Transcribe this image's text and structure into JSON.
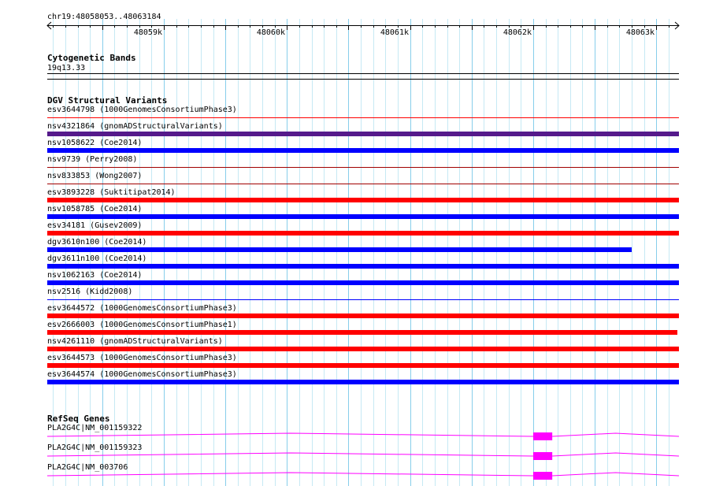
{
  "ruler": {
    "location": "chr19:48058053..48063184",
    "start": 48058053,
    "end": 48063184,
    "major_ticks": [
      {
        "pos": 48059000,
        "label": "48059k"
      },
      {
        "pos": 48060000,
        "label": "48060k"
      },
      {
        "pos": 48061000,
        "label": "48061k"
      },
      {
        "pos": 48062000,
        "label": "48062k"
      },
      {
        "pos": 48063000,
        "label": "48063k"
      }
    ]
  },
  "tracks": {
    "cytoband": {
      "title": "Cytogenetic Bands",
      "band_label": "19q13.33",
      "color": "#000000"
    },
    "dgv": {
      "title": "DGV Structural Variants",
      "features": [
        {
          "label": "esv3644798 (1000GenomesConsortiumPhase3)",
          "color": "#ff0000",
          "style": "line",
          "start": 48058053,
          "end": 48063184
        },
        {
          "label": "nsv4321864 (gnomADStructuralVariants)",
          "color": "#551a8b",
          "style": "bar",
          "start": 48058053,
          "end": 48063184
        },
        {
          "label": "nsv1058622 (Coe2014)",
          "color": "#0000ff",
          "style": "bar",
          "start": 48058053,
          "end": 48063184
        },
        {
          "label": "nsv9739 (Perry2008)",
          "color": "#a00000",
          "style": "line",
          "start": 48058053,
          "end": 48063184
        },
        {
          "label": "nsv833853 (Wong2007)",
          "color": "#a00000",
          "style": "line",
          "start": 48058053,
          "end": 48063184
        },
        {
          "label": "esv3893228 (Suktitipat2014)",
          "color": "#ff0000",
          "style": "bar",
          "start": 48058053,
          "end": 48063184
        },
        {
          "label": "nsv1058785 (Coe2014)",
          "color": "#0000ff",
          "style": "bar",
          "start": 48058053,
          "end": 48063184
        },
        {
          "label": "esv34181 (Gusev2009)",
          "color": "#ff0000",
          "style": "bar",
          "start": 48058053,
          "end": 48063184
        },
        {
          "label": "dgv3610n100 (Coe2014)",
          "color": "#0000ff",
          "style": "bar",
          "start": 48058053,
          "end": 48062800
        },
        {
          "label": "dgv3611n100 (Coe2014)",
          "color": "#0000ff",
          "style": "bar",
          "start": 48058053,
          "end": 48063184
        },
        {
          "label": "nsv1062163 (Coe2014)",
          "color": "#0000ff",
          "style": "bar",
          "start": 48058053,
          "end": 48063184
        },
        {
          "label": "nsv2516 (Kidd2008)",
          "color": "#0000ff",
          "style": "line",
          "start": 48058053,
          "end": 48063184
        },
        {
          "label": "esv3644572 (1000GenomesConsortiumPhase3)",
          "color": "#ff0000",
          "style": "bar",
          "start": 48058053,
          "end": 48063184
        },
        {
          "label": "esv2666003 (1000GenomesConsortiumPhase1)",
          "color": "#ff0000",
          "style": "bar",
          "start": 48058053,
          "end": 48063170
        },
        {
          "label": "nsv4261110 (gnomADStructuralVariants)",
          "color": "#ff0000",
          "style": "bar",
          "start": 48058053,
          "end": 48063184
        },
        {
          "label": "esv3644573 (1000GenomesConsortiumPhase3)",
          "color": "#ff0000",
          "style": "bar",
          "start": 48058053,
          "end": 48063184
        },
        {
          "label": "esv3644574 (1000GenomesConsortiumPhase3)",
          "color": "#0000ff",
          "style": "bar",
          "start": 48058053,
          "end": 48063184
        }
      ]
    },
    "refseq": {
      "title": "RefSeq Genes",
      "color": "#ff00ff",
      "genes": [
        {
          "label": "PLA2G4C|NM_001159322",
          "start": 48058053,
          "end": 48063184,
          "exons": [
            {
              "start": 48062000,
              "end": 48062155
            }
          ]
        },
        {
          "label": "PLA2G4C|NM_001159323",
          "start": 48058053,
          "end": 48063184,
          "exons": [
            {
              "start": 48062000,
              "end": 48062155
            }
          ]
        },
        {
          "label": "PLA2G4C|NM_003706",
          "start": 48058053,
          "end": 48063184,
          "exons": [
            {
              "start": 48062000,
              "end": 48062155
            }
          ]
        }
      ]
    }
  },
  "colors": {
    "grid_major": "#87ceeb",
    "grid_minor": "#c6e9f4"
  }
}
